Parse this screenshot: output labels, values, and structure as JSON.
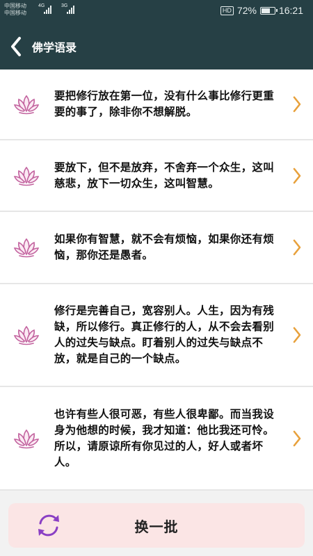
{
  "status_bar": {
    "carrier_1": "中国移动",
    "carrier_2": "中国移动",
    "network_1": "4G",
    "network_2": "3G",
    "hd": "HD",
    "battery": "72%",
    "battery_level": 0.72,
    "time": "16:21"
  },
  "header": {
    "title": "佛学语录",
    "back_icon": "chevron-left-icon"
  },
  "quotes": [
    {
      "text": "要把修行放在第一位，没有什么事比修行更重要的事了，除非你不想解脱。",
      "icon": "lotus-icon"
    },
    {
      "text": "要放下，但不是放弃，不舍弃一个众生，这叫慈悲，放下一切众生，这叫智慧。",
      "icon": "lotus-icon"
    },
    {
      "text": "如果你有智慧，就不会有烦恼，如果你还有烦恼，那你还是愚者。",
      "icon": "lotus-icon"
    },
    {
      "text": "修行是完善自己，宽容别人。人生，因为有残缺，所以修行。真正修行的人，从不会去看别人的过失与缺点。盯着别人的过失与缺点不放，就是自己的一个缺点。",
      "icon": "lotus-icon"
    },
    {
      "text": "也许有些人很可恶，有些人很卑鄙。而当我设身为他想的时候，我才知道：他比我还可怜。所以，请原谅所有你见过的人，好人或者坏人。",
      "icon": "lotus-icon"
    }
  ],
  "footer": {
    "refresh_label": "换一批",
    "refresh_icon": "refresh-icon"
  },
  "colors": {
    "header_bg": "#264045",
    "chevron": "#e8a13c",
    "lotus": "#c2629e",
    "button_bg": "#fbe5e5",
    "refresh_icon": "#8a3fc4"
  }
}
